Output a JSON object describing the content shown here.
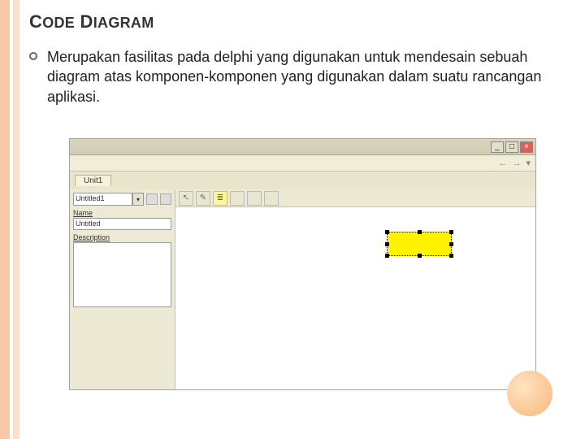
{
  "slide": {
    "title_word1": "C",
    "title_word1b": "ODE",
    "title_word2": "D",
    "title_word2b": "IAGRAM",
    "body": "Merupakan fasilitas pada delphi yang digunakan untuk mendesain sebuah diagram atas komponen-komponen yang digunakan dalam suatu rancangan aplikasi."
  },
  "app": {
    "tab": "Unit1",
    "nav_back": "←",
    "nav_fwd": "→",
    "nav_menu": "▾",
    "win_min": "_",
    "win_max": "□",
    "win_close": "×",
    "tools": {
      "arrow": "↖",
      "note": "✎",
      "hl": "≣",
      "t1": " ",
      "t2": " ",
      "t3": " "
    }
  },
  "panel": {
    "combo_value": "Untitled1",
    "combo_arrow": "▾",
    "name_label": "Name",
    "name_value": "Untitled",
    "desc_label": "Description"
  }
}
